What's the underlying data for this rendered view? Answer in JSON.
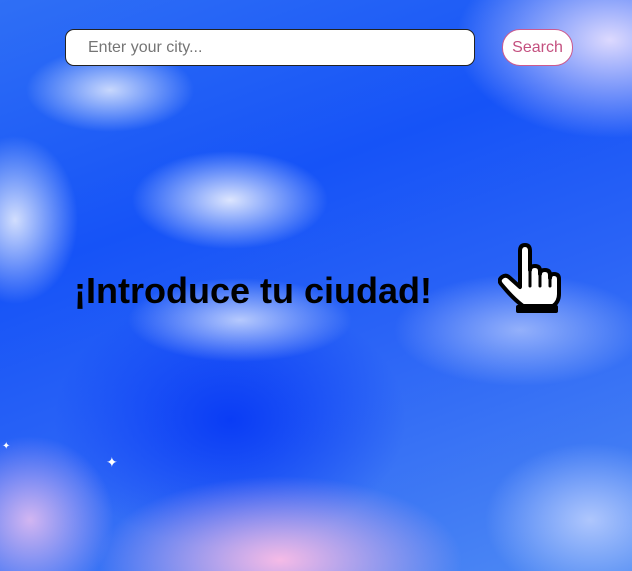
{
  "search": {
    "placeholder": "Enter your city...",
    "value": "",
    "button_label": "Search"
  },
  "main": {
    "prompt": "¡Introduce tu ciudad!",
    "pointer_icon": "pointing-hand-icon"
  },
  "colors": {
    "search_button_text": "#c4507f",
    "search_button_border": "#cc5a8e",
    "sky_blue": "#1653f7",
    "blossom_pink": "#ffbee6"
  }
}
